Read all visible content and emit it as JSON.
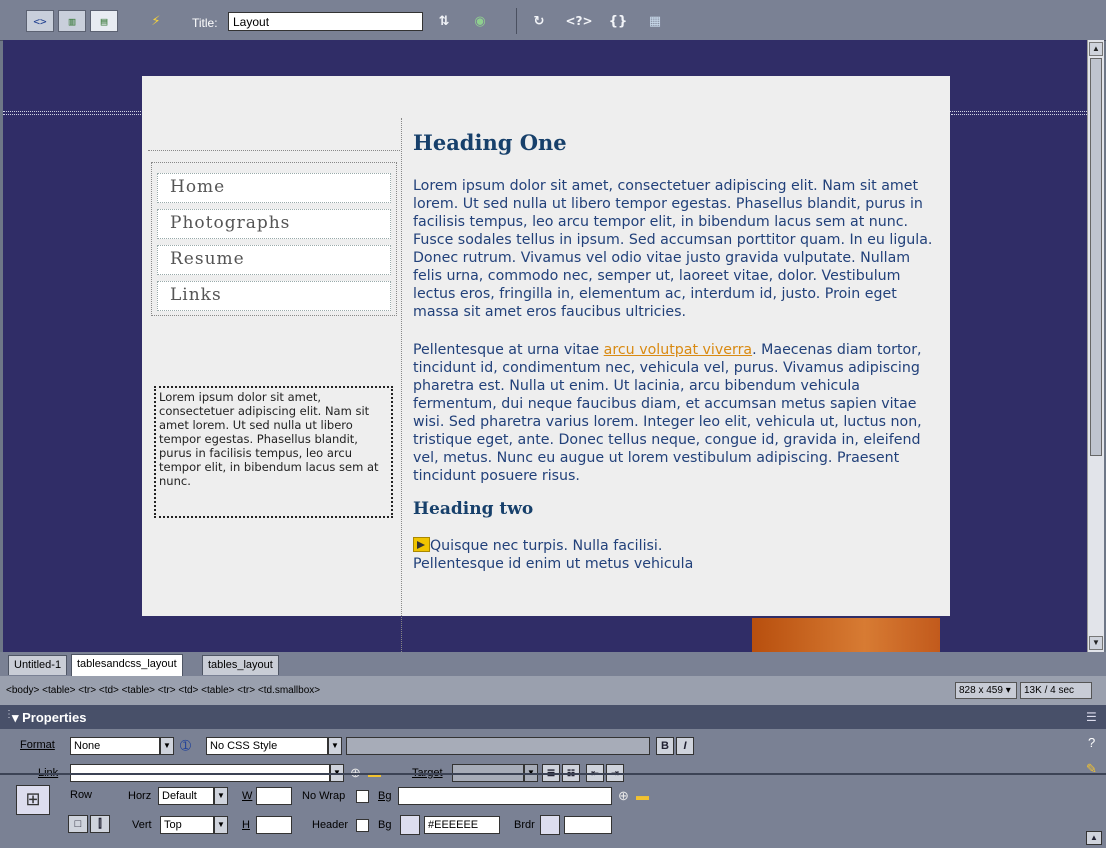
{
  "toolbar": {
    "view_buttons": [
      "<>",
      "",
      ""
    ],
    "title_label": "Title:",
    "title_value": "Layout"
  },
  "nav": {
    "items": [
      "Home",
      "Photographs",
      "Resume",
      "Links"
    ]
  },
  "sidebar_text": "Lorem ipsum dolor sit amet, consectetuer adipiscing elit. Nam sit amet lorem. Ut sed nulla ut libero tempor egestas. Phasellus blandit, purus in facilisis tempus, leo arcu tempor elit, in bibendum lacus sem at nunc.",
  "content": {
    "heading1": "Heading One",
    "para1": "Lorem ipsum dolor sit amet, consectetuer adipiscing elit. Nam sit amet lorem. Ut sed nulla ut libero tempor egestas. Phasellus blandit, purus in facilisis tempus, leo arcu tempor elit, in bibendum lacus sem at nunc. Fusce sodales tellus in ipsum. Sed accumsan porttitor quam. In eu ligula. Donec rutrum. Vivamus vel odio vitae justo gravida vulputate. Nullam felis urna, commodo nec, semper ut, laoreet vitae, dolor. Vestibulum lectus eros, fringilla in, elementum ac, interdum id, justo. Proin eget massa sit amet eros faucibus ultricies.",
    "para2_before": "Pellentesque at urna vitae ",
    "para2_link": "arcu volutpat viverra",
    "para2_after": ". Maecenas diam tortor, tincidunt id, condimentum nec, vehicula vel, purus. Vivamus adipiscing pharetra est. Nulla ut enim. Ut lacinia, arcu bibendum vehicula fermentum, dui neque faucibus diam, et accumsan metus sapien vitae wisi. Sed pharetra varius lorem. Integer leo elit, vehicula ut, luctus non, tristique eget, ante. Donec tellus neque, congue id, gravida in, eleifend vel, metus. Nunc eu augue ut lorem vestibulum adipiscing. Praesent tincidunt posuere risus.",
    "heading2": "Heading two",
    "para3": "Quisque nec turpis. Nulla facilisi. Pellentesque id enim ut metus vehicula"
  },
  "doc_tabs": [
    "Untitled-1",
    "tablesandcss_layout",
    "tables_layout"
  ],
  "status": {
    "tag_selector": "<body> <table> <tr> <td> <table> <tr> <td> <table> <tr> <td.smallbox>",
    "window_size": "828 x 459",
    "download": "13K / 4 sec"
  },
  "properties": {
    "title": "Properties",
    "format_label": "Format",
    "format_value": "None",
    "style_value": "No CSS Style",
    "link_label": "Link",
    "target_label": "Target",
    "row_label": "Row",
    "horz_label": "Horz",
    "horz_value": "Default",
    "w_label": "W",
    "nowrap_label": "No Wrap",
    "bg_label": "Bg",
    "vert_label": "Vert",
    "vert_value": "Top",
    "h_label": "H",
    "header_label": "Header",
    "bg2_label": "Bg",
    "bg_color": "#EEEEEE",
    "brdr_label": "Brdr",
    "bold": "B",
    "italic": "I"
  }
}
